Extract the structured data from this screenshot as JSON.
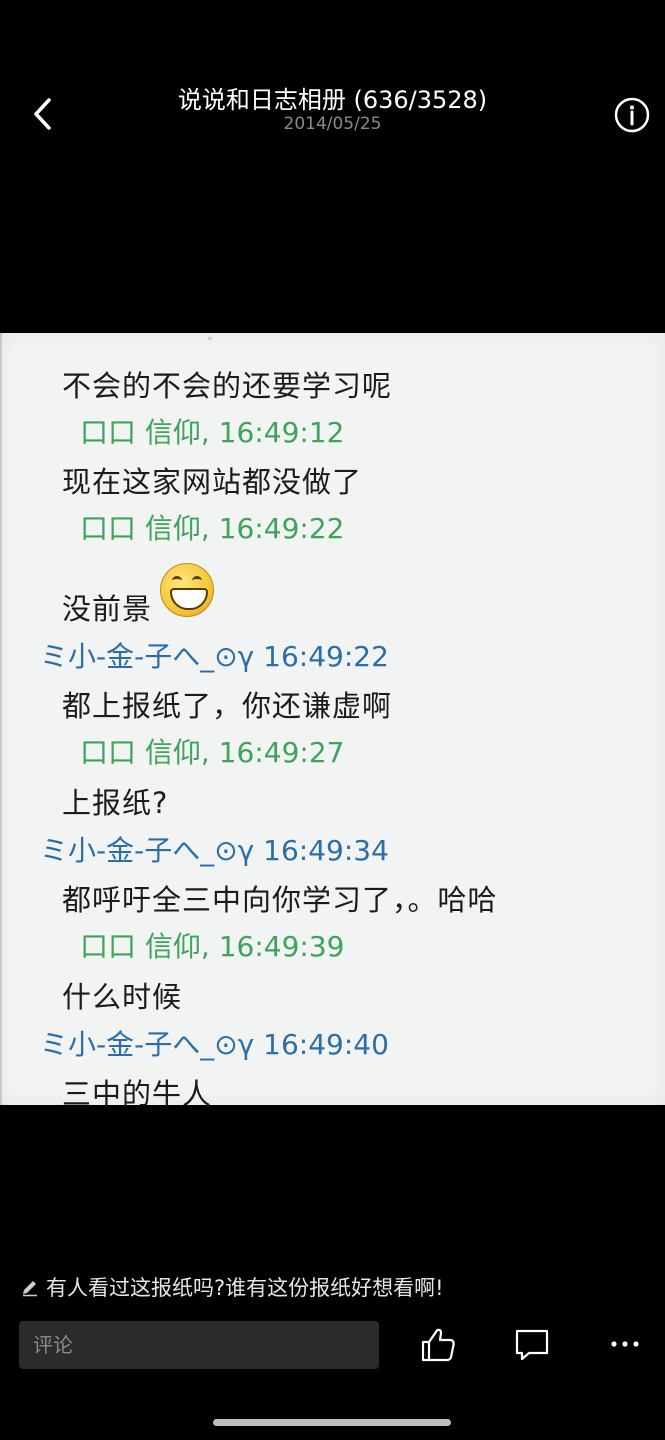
{
  "header": {
    "title": "说说和日志相册 (636/3528)",
    "date": "2014/05/25",
    "back_icon": "chevron-left-icon",
    "info_icon": "info-circle-icon"
  },
  "photo": {
    "messages": [
      {
        "text": "不会的不会的还要学习呢"
      },
      {
        "meta": "口口 信仰, 16:49:12"
      },
      {
        "text": "现在这家网站都没做了"
      },
      {
        "meta": "口口 信仰, 16:49:22"
      },
      {
        "text": "没前景"
      },
      {
        "meta": "ミ小-金-子へ_⊙γ 16:49:22"
      },
      {
        "text": "都上报纸了，你还谦虚啊"
      },
      {
        "meta": "口口 信仰, 16:49:27"
      },
      {
        "text": "上报纸?"
      },
      {
        "meta": "ミ小-金-子へ_⊙γ 16:49:34"
      },
      {
        "text": "都呼吁全三中向你学习了，。哈哈"
      },
      {
        "meta": "口口 信仰, 16:49:39"
      },
      {
        "text": "什么时候"
      },
      {
        "meta": "ミ小-金-子へ_⊙γ 16:49:40"
      },
      {
        "text": "三中的牛人"
      }
    ],
    "colors": {
      "green_name": "#3fa35a",
      "blue_name": "#2c6fa8",
      "text": "#1b1b1b",
      "background": "#f2f3f3"
    }
  },
  "footer": {
    "caption": "有人看过这报纸吗?谁有这份报纸好想看啊!",
    "caption_icon": "pencil-icon",
    "comment_placeholder": "评论",
    "like_icon": "thumbs-up-icon",
    "comment_icon": "speech-bubble-icon",
    "more_icon": "more-dots-icon"
  }
}
